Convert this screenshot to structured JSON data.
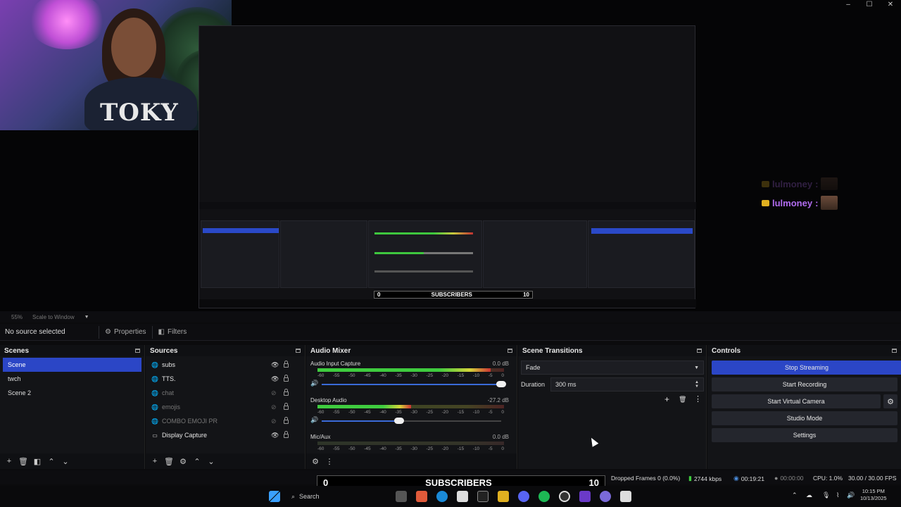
{
  "window": {
    "controls": [
      "–",
      "☐",
      "✕"
    ]
  },
  "chat": {
    "username": "lulmoney",
    "separator": ":"
  },
  "webcam": {
    "shirt_text": "TOKY"
  },
  "inner_obs": {
    "subs_label": "SUBSCRIBERS",
    "subs_count_left": "0",
    "subs_count_right": "10",
    "sources": [
      "subs",
      "TTS",
      "chat",
      "emojis",
      "COMBO EMOJI PR",
      "Display Capture"
    ],
    "scenes": [
      "Scene",
      "twch",
      "Scene 2"
    ],
    "controls": [
      "Stop Streaming",
      "Start Recording",
      "Start Virtual Camera",
      "Studio Mode",
      "Settings"
    ]
  },
  "preview_toolbar": {
    "zoom": "55%",
    "scale_mode": "Scale to Window"
  },
  "source_toolbar": {
    "label": "No source selected",
    "properties": "Properties",
    "filters": "Filters"
  },
  "scenes": {
    "title": "Scenes",
    "items": [
      {
        "label": "Scene",
        "selected": true
      },
      {
        "label": "twch",
        "selected": false
      },
      {
        "label": "Scene 2",
        "selected": false
      }
    ]
  },
  "sources": {
    "title": "Sources",
    "items": [
      {
        "label": "subs",
        "icon": "globe-icon",
        "visible": true
      },
      {
        "label": "TTS.",
        "icon": "globe-icon",
        "visible": true
      },
      {
        "label": "chat",
        "icon": "globe-icon",
        "visible": false
      },
      {
        "label": "emojis",
        "icon": "globe-icon",
        "visible": false
      },
      {
        "label": "COMBO EMOJI PR",
        "icon": "globe-icon",
        "visible": false
      },
      {
        "label": "Display Capture",
        "icon": "monitor-icon",
        "visible": true
      }
    ]
  },
  "audio_mixer": {
    "title": "Audio Mixer",
    "scale": [
      "-60",
      "-55",
      "-50",
      "-45",
      "-40",
      "-35",
      "-30",
      "-25",
      "-20",
      "-15",
      "-10",
      "-5",
      "0"
    ],
    "channels": [
      {
        "name": "Audio Input Capture",
        "db": "0.0 dB",
        "level": 0.93,
        "volume": 1.0
      },
      {
        "name": "Desktop Audio",
        "db": "-27.2 dB",
        "level": 0.5,
        "volume": 0.43
      },
      {
        "name": "Mic/Aux",
        "db": "0.0 dB",
        "level": 0.0,
        "volume": 1.0
      }
    ]
  },
  "scene_transitions": {
    "title": "Scene Transitions",
    "transition": "Fade",
    "duration_label": "Duration",
    "duration_value": "300 ms"
  },
  "controls": {
    "title": "Controls",
    "stop_streaming": "Stop Streaming",
    "start_recording": "Start Recording",
    "start_virtual_camera": "Start Virtual Camera",
    "studio_mode": "Studio Mode",
    "settings": "Settings"
  },
  "status_bar": {
    "dropped_frames": "Dropped Frames 0 (0.0%)",
    "bitrate": "2744 kbps",
    "stream_time": "00:19:21",
    "record_time": "00:00:00",
    "cpu": "CPU: 1.0%",
    "fps": "30.00 / 30.00 FPS"
  },
  "subscribers_widget": {
    "left": "0",
    "label": "SUBSCRIBERS",
    "right": "10"
  },
  "taskbar": {
    "search_placeholder": "Search",
    "time": "10:15 PM",
    "date": "10/13/2025"
  },
  "colors": {
    "accent": "#2b46c6",
    "chat_name": "#b16cf0",
    "meter_green": "#3fcc3f"
  }
}
